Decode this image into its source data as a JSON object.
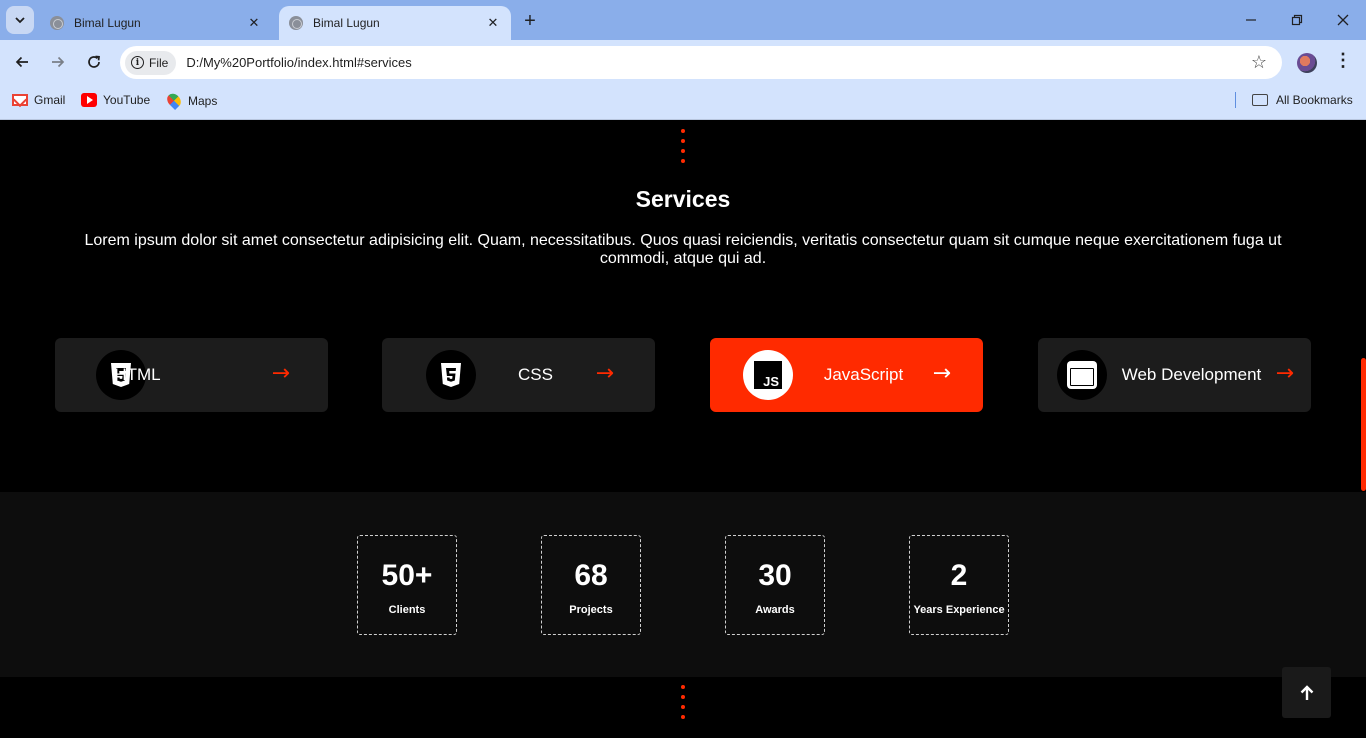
{
  "browser": {
    "tabs": [
      {
        "title": "Bimal Lugun",
        "active": false
      },
      {
        "title": "Bimal Lugun",
        "active": true
      }
    ],
    "new_tab_icon": "plus-icon",
    "address": {
      "scheme_chip": "File",
      "url": "D:/My%20Portfolio/index.html#services"
    },
    "bookmarks": [
      {
        "label": "Gmail",
        "icon": "gmail-icon"
      },
      {
        "label": "YouTube",
        "icon": "youtube-icon"
      },
      {
        "label": "Maps",
        "icon": "maps-icon"
      }
    ],
    "all_bookmarks": "All Bookmarks"
  },
  "services": {
    "title": "Services",
    "description": "Lorem ipsum dolor sit amet consectetur adipisicing elit. Quam, necessitatibus. Quos quasi reiciendis, veritatis consectetur quam sit cumque neque exercitationem fuga ut commodi, atque qui ad.",
    "cards": [
      {
        "label": "HTML",
        "icon": "html5-icon",
        "highlighted": false
      },
      {
        "label": "CSS",
        "icon": "css3-icon",
        "highlighted": false
      },
      {
        "label": "JavaScript",
        "icon": "js-icon",
        "highlighted": true
      },
      {
        "label": "Web Development",
        "icon": "window-icon",
        "highlighted": false
      }
    ]
  },
  "stats": [
    {
      "value": "50+",
      "caption": "Clients"
    },
    {
      "value": "68",
      "caption": "Projects"
    },
    {
      "value": "30",
      "caption": "Awards"
    },
    {
      "value": "2",
      "caption": "Years Experience"
    }
  ],
  "colors": {
    "accent": "#ff2a00",
    "page_bg": "#000000",
    "card_bg": "#1c1c1c",
    "stats_bg": "#0d0d0d"
  }
}
